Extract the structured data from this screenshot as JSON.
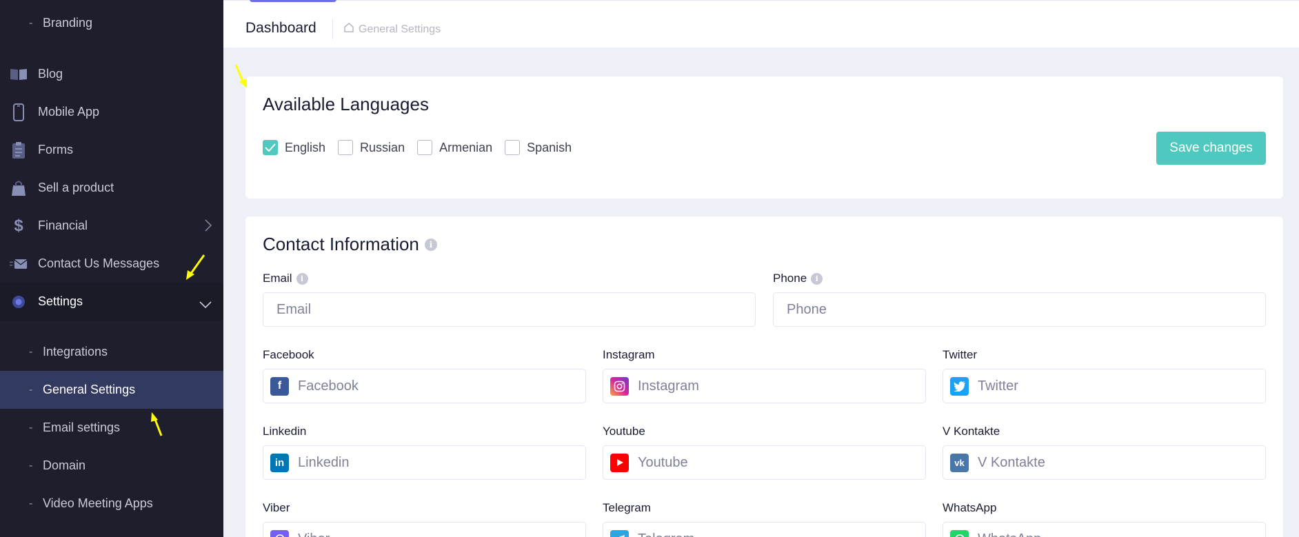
{
  "sidebar": {
    "branding": "Branding",
    "items": [
      {
        "label": "Blog",
        "icon": "book-icon"
      },
      {
        "label": "Mobile App",
        "icon": "phone-icon"
      },
      {
        "label": "Forms",
        "icon": "clipboard-icon"
      },
      {
        "label": "Sell a product",
        "icon": "shopping-bag-icon"
      },
      {
        "label": "Financial",
        "icon": "dollar-icon"
      },
      {
        "label": "Contact Us Messages",
        "icon": "envelope-icon"
      },
      {
        "label": "Settings",
        "icon": "gear-icon"
      }
    ],
    "settings_sub": [
      {
        "label": "Integrations"
      },
      {
        "label": "General Settings"
      },
      {
        "label": "Email settings"
      },
      {
        "label": "Domain"
      },
      {
        "label": "Video Meeting Apps"
      }
    ],
    "dash": "-"
  },
  "header": {
    "title": "Dashboard",
    "breadcrumb": "General Settings"
  },
  "languages": {
    "title": "Available Languages",
    "options": [
      {
        "label": "English",
        "checked": true
      },
      {
        "label": "Russian",
        "checked": false
      },
      {
        "label": "Armenian",
        "checked": false
      },
      {
        "label": "Spanish",
        "checked": false
      }
    ],
    "save_label": "Save changes"
  },
  "contact": {
    "title": "Contact Information",
    "email": {
      "label": "Email",
      "placeholder": "Email",
      "value": ""
    },
    "phone": {
      "label": "Phone",
      "placeholder": "Phone",
      "value": ""
    },
    "socials": [
      {
        "label": "Facebook",
        "placeholder": "Facebook",
        "icon": "facebook-icon",
        "color": "#3b5998"
      },
      {
        "label": "Instagram",
        "placeholder": "Instagram",
        "icon": "instagram-icon",
        "color": "#d6249f"
      },
      {
        "label": "Twitter",
        "placeholder": "Twitter",
        "icon": "twitter-icon",
        "color": "#1da1f2"
      },
      {
        "label": "Linkedin",
        "placeholder": "Linkedin",
        "icon": "linkedin-icon",
        "color": "#0077b5"
      },
      {
        "label": "Youtube",
        "placeholder": "Youtube",
        "icon": "youtube-icon",
        "color": "#ff0000"
      },
      {
        "label": "V Kontakte",
        "placeholder": "V Kontakte",
        "icon": "vk-icon",
        "color": "#4a76a8"
      },
      {
        "label": "Viber",
        "placeholder": "Viber",
        "icon": "viber-icon",
        "color": "#7360f2"
      },
      {
        "label": "Telegram",
        "placeholder": "Telegram",
        "icon": "telegram-icon",
        "color": "#2ca5e0"
      },
      {
        "label": "WhatsApp",
        "placeholder": "WhatsApp",
        "icon": "whatsapp-icon",
        "color": "#25d366"
      }
    ]
  },
  "colors": {
    "accent": "#4fc9bf",
    "sidebar_bg": "#1e1e2d",
    "sidebar_active": "#333a60",
    "annotation_arrow": "#ffff00"
  }
}
